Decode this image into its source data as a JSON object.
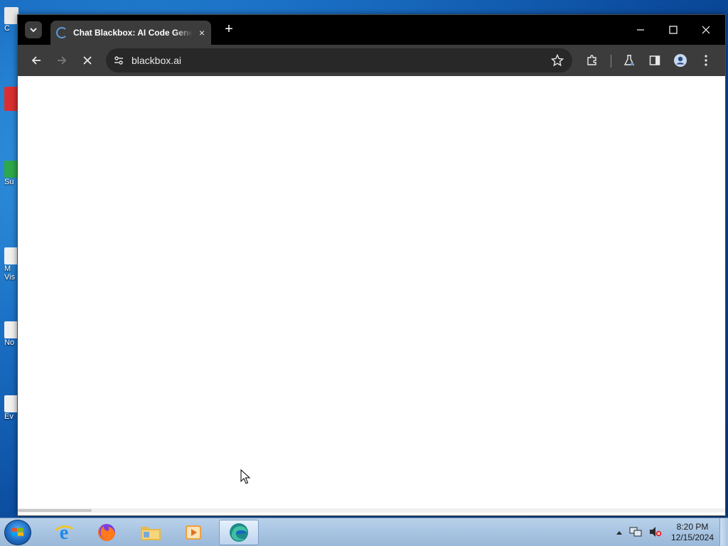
{
  "desktop": {
    "icons": [
      {
        "label": "C"
      },
      {
        "label": ""
      },
      {
        "label": "Su"
      },
      {
        "label": "M"
      },
      {
        "label": "Vis"
      },
      {
        "label": "No"
      },
      {
        "label": "Ev"
      }
    ]
  },
  "browser": {
    "tab": {
      "title": "Chat Blackbox: AI Code Generator",
      "close_glyph": "×"
    },
    "new_tab_glyph": "+",
    "window_controls": {
      "minimize": "–",
      "maximize": "☐",
      "close": "✕"
    },
    "address": {
      "url": "blackbox.ai"
    },
    "icons": {
      "back": "back-arrow-icon",
      "forward": "forward-arrow-icon",
      "stop": "stop-loading-icon",
      "site_info": "tune-icon",
      "bookmark": "star-icon",
      "extensions": "puzzle-icon",
      "labs": "flask-icon",
      "side_panel": "side-panel-icon",
      "profile": "account-icon",
      "menu": "kebab-menu-icon"
    },
    "accent": "#5a9bd8"
  },
  "taskbar": {
    "apps": [
      {
        "name": "internet-explorer"
      },
      {
        "name": "firefox"
      },
      {
        "name": "file-explorer"
      },
      {
        "name": "media-player"
      },
      {
        "name": "edge-browser",
        "active": true
      }
    ],
    "clock": {
      "time": "8:20 PM",
      "date": "12/15/2024"
    }
  }
}
